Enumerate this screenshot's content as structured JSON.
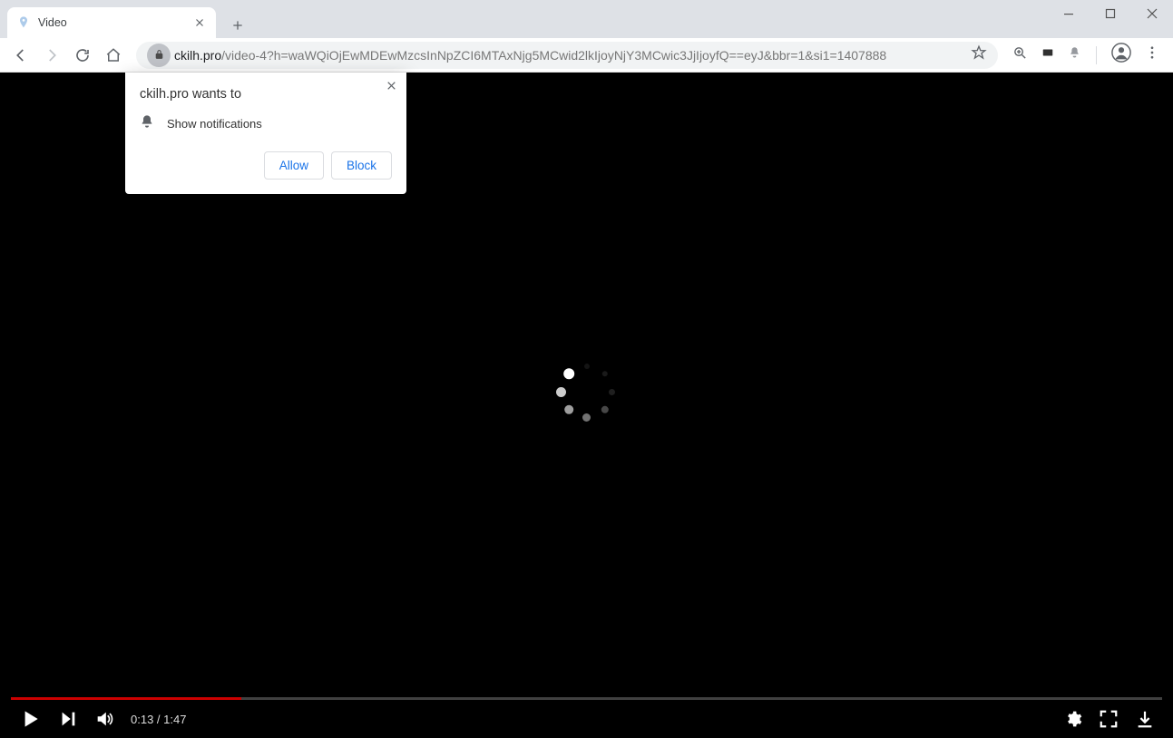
{
  "tab": {
    "title": "Video"
  },
  "url": {
    "origin": "ckilh.pro",
    "path": "/video-4?h=waWQiOjEwMDEwMzcsInNpZCI6MTAxNjg5MCwid2lkIjoyNjY3MCwic3JjIjoyfQ==eyJ&bbr=1&si1=1407888"
  },
  "permission": {
    "title": "ckilh.pro wants to",
    "item": "Show notifications",
    "allow": "Allow",
    "block": "Block"
  },
  "player": {
    "current": "0:13",
    "duration": "1:47",
    "progress_percent": 20
  }
}
